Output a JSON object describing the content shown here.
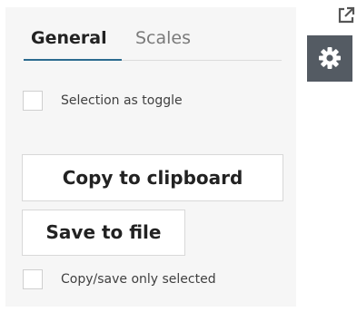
{
  "tabs": {
    "general": "General",
    "scales": "Scales",
    "active": "General"
  },
  "options": {
    "selection_toggle_label": "Selection as toggle",
    "selection_toggle_checked": false,
    "copy_save_selected_label": "Copy/save only selected",
    "copy_save_selected_checked": false
  },
  "actions": {
    "copy_label": "Copy to clipboard",
    "save_label": "Save to file"
  },
  "icons": {
    "settings": "gear-icon",
    "open_external": "external-link-icon"
  },
  "colors": {
    "panel_background": "#f6f6f6",
    "tab_underline": "#2b6a8f",
    "gear_button": "#545b63"
  }
}
